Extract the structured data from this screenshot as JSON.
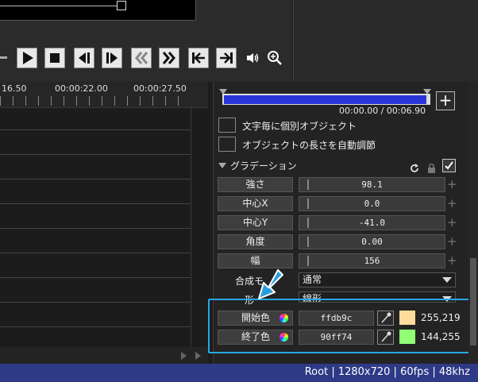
{
  "player": {
    "buttons": [
      {
        "name": "play-button",
        "icon": "play-icon"
      },
      {
        "name": "stop-button",
        "icon": "stop-icon"
      },
      {
        "name": "prev-frame-button",
        "icon": "prev-frame-icon"
      },
      {
        "name": "next-frame-button",
        "icon": "next-frame-icon"
      },
      {
        "name": "rewind-button",
        "icon": "rewind-icon"
      },
      {
        "name": "fast-forward-button",
        "icon": "fast-forward-icon"
      },
      {
        "name": "go-to-start-button",
        "icon": "go-to-start-icon"
      },
      {
        "name": "go-to-end-button",
        "icon": "go-to-end-icon"
      }
    ],
    "volume_icon": "volume-icon",
    "zoom_icon": "zoom-icon"
  },
  "timeline": {
    "time_labels": [
      "16.50",
      "00:00:22.00",
      "00:00:27.50"
    ]
  },
  "object_panel": {
    "time_readout": "00:00.00 / 00:06.90",
    "add_label": "+",
    "checkboxes": [
      {
        "label": "文字毎に個別オブジェクト",
        "checked": false
      },
      {
        "label": "オブジェクトの長さを自動調節",
        "checked": false
      }
    ]
  },
  "gradation": {
    "title": "グラデーション",
    "params": [
      {
        "label": "強さ",
        "value": "98.1"
      },
      {
        "label": "中心X",
        "value": "0.0"
      },
      {
        "label": "中心Y",
        "value": "-41.0"
      },
      {
        "label": "角度",
        "value": "0.00"
      },
      {
        "label": "幅",
        "value": "156"
      }
    ],
    "blend_label": "合成モ",
    "blend_value": "通常",
    "shape_label": "形",
    "shape_value": "線形",
    "start_color": {
      "label": "開始色",
      "hex": "ffdb9c",
      "swatch": "#ffdb9c",
      "rgb": "255,219"
    },
    "end_color": {
      "label": "終了色",
      "hex": "90ff74",
      "swatch": "#90ff74",
      "rgb": "144,255"
    }
  },
  "status": {
    "text": "Root | 1280x720 | 60fps | 48khz"
  },
  "colors": {
    "accent_blue": "#29a7e3",
    "status_bar": "#2e3a86",
    "range_bar": "#2a35d9"
  }
}
